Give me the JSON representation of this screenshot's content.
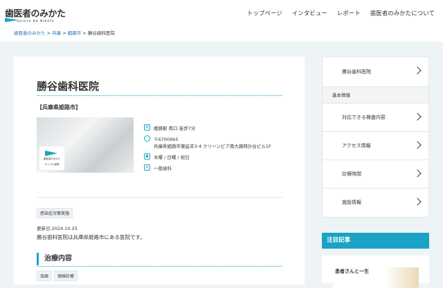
{
  "header": {
    "logo_text": "歯医者のみかた",
    "logo_sub": "HAISYA NO MIKATA",
    "nav": [
      "トップページ",
      "インタビュー",
      "レポート",
      "歯医者のみかたについて"
    ]
  },
  "breadcrumb": {
    "items": [
      "歯医者のみかた",
      "兵庫",
      "姫路市"
    ],
    "current": "勝谷歯科医院",
    "sep": ">"
  },
  "clinic": {
    "name": "勝谷歯科医院",
    "prefecture": "【兵庫県姫路市】",
    "image_logo": "歯医者のみかた",
    "image_caption": "サンプル画像",
    "access": "姫路駅 南口 徒歩7分",
    "postal": "〒6700965",
    "address": "兵庫県姫路市東延末3-4 クリーンピア南大路時計台ビル1F",
    "closed": "木曜 / 日曜 / 祝日",
    "department": "一般歯科",
    "tag": "感染症対策実施",
    "updated": "更新日:2024.10.25",
    "description": "勝谷歯科医院は兵庫県姫路市にある医院です。"
  },
  "treatment": {
    "heading": "治療内容",
    "tags": [
      "虫歯",
      "保険診療"
    ]
  },
  "sidebar": {
    "clinic_link": "勝谷歯科医院",
    "section": "基本情報",
    "items": [
      "対応できる検査内容",
      "アクセス情報",
      "診療時間",
      "施設情報"
    ]
  },
  "featured": {
    "heading": "注目記事",
    "card_title": "患者さんと一生"
  },
  "colors": {
    "accent": "#1aa3c4"
  }
}
